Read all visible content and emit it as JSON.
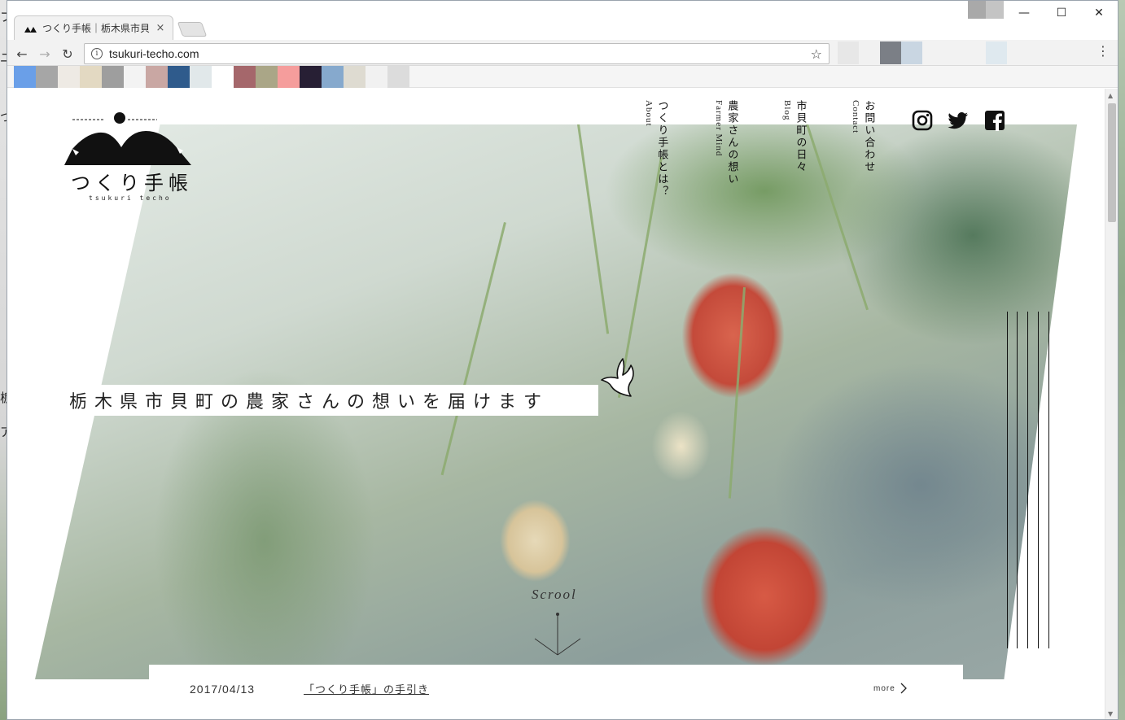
{
  "browser": {
    "tab_title": "つくり手帳｜栃木県市貝",
    "tab_close": "×",
    "url": "tsukuri-techo.com",
    "back": "←",
    "forward": "→",
    "reload": "↻",
    "info": "i",
    "star": "☆",
    "menu": "⋮",
    "minimize": "—",
    "maximize": "☐",
    "close": "✕",
    "bookmark_swatches": [
      "#6a9fe8",
      "#a6a6a6",
      "#eeeae4",
      "#e3d9c2",
      "#9e9e9e",
      "#f3f3f3",
      "#c9a7a3",
      "#2f5b8c",
      "#e1e8ea",
      "#ffffff",
      "#a5676b",
      "#aaa687",
      "#f59d9c",
      "#271f34",
      "#86a9cd",
      "#dedbd1",
      "#f1f1f1",
      "#dcdcdc"
    ],
    "ext_swatches": [
      "#e7e7e7",
      "#f1f1f1",
      "#7b7f86",
      "#c9d6e2",
      "#f2f2f2",
      "#f2f2f2",
      "#f2f2f2",
      "#dfe9ef",
      "#f2f2f2"
    ]
  },
  "desktop": {
    "glyphs": [
      "フ",
      "ユ",
      "つ",
      "栃",
      "ア"
    ]
  },
  "site": {
    "logo": {
      "title": "つくり手帳",
      "subtitle": "tsukuri techo"
    },
    "nav": [
      {
        "jp": "つくり手帳とは？",
        "en": "About"
      },
      {
        "jp": "農家さんの想い",
        "en": "Farmer Mind"
      },
      {
        "jp": "市貝町の日々",
        "en": "Blog"
      },
      {
        "jp": "お問い合わせ",
        "en": "Contact"
      }
    ],
    "social": [
      "instagram-icon",
      "twitter-icon",
      "facebook-icon"
    ],
    "headline": "栃木県市貝町の農家さんの想いを届けます",
    "scroll_label": "Scrool",
    "news": {
      "date": "2017/04/13",
      "title": "「つくり手帳」の手引き",
      "more": "more"
    }
  }
}
